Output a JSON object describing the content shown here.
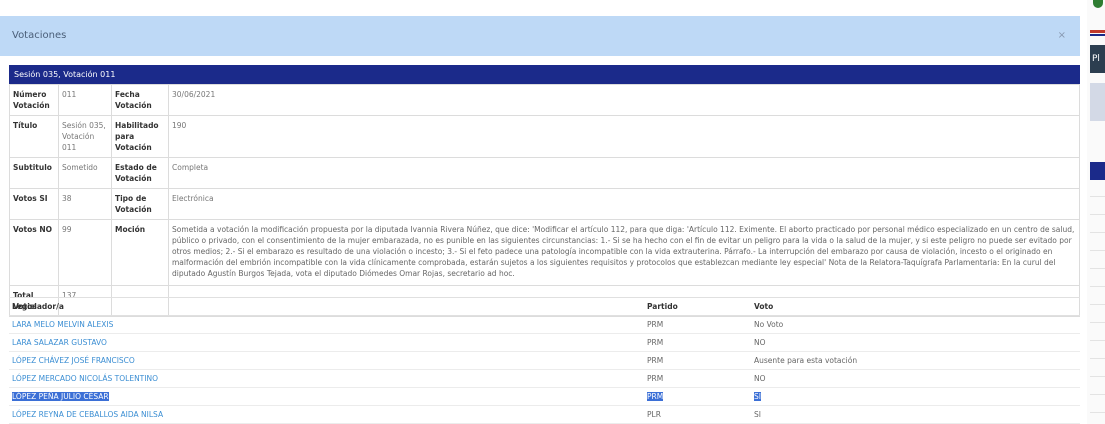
{
  "modal": {
    "title": "Votaciones",
    "close_label": "×"
  },
  "background": {
    "nav_label": "Pl"
  },
  "session": {
    "header": "Sesión 035, Votación 011"
  },
  "info": {
    "numero_votacion_label": "Número Votación",
    "numero_votacion": "011",
    "fecha_votacion_label": "Fecha Votación",
    "fecha_votacion": "30/06/2021",
    "titulo_label": "Título",
    "titulo": "Sesión 035, Votación 011",
    "habilitado_label": "Habilitado para Votación",
    "habilitado": "190",
    "subtitulo_label": "Subtitulo",
    "subtitulo": "Sometido",
    "estado_label": "Estado de Votación",
    "estado": "Completa",
    "votos_si_label": "Votos SI",
    "votos_si": "38",
    "tipo_label": "Tipo de Votación",
    "tipo": "Electrónica",
    "votos_no_label": "Votos NO",
    "votos_no": "99",
    "mocion_label": "Moción",
    "mocion": "Sometida a votación la modificación propuesta por la diputada Ivannia Rivera Núñez, que dice: 'Modificar el artículo 112, para que diga: 'Artículo 112. Eximente. El aborto practicado por personal médico especializado en un centro de salud, público o privado, con el consentimiento de la mujer embarazada, no es punible en las siguientes circunstancias: 1.- Si se ha hecho con el fin de evitar un peligro para la vida o la salud de la mujer, y si este peligro no puede ser evitado por otros medios; 2.- Si el embarazo es resultado de una violación o incesto; 3.- Si el feto padece una patología incompatible con la vida extrauterina. Párrafo.- La interrupción del embarazo por causa de violación, incesto o el originado en malformación del embrión incompatible con la vida clínicamente comprobada, estarán sujetos a los siguientes requisitos y protocolos que establezcan mediante ley especial' Nota de la Relatora-Taquígrafa Parlamentaria: En la curul del diputado Agustín Burgos Tejada, vota el diputado Diómedes Omar Rojas, secretario ad hoc.",
    "total_votos_label": "Total Votos",
    "total_votos": "137"
  },
  "votes": {
    "headers": {
      "legislador": "Legislador/a",
      "partido": "Partido",
      "voto": "Voto"
    },
    "rows": [
      {
        "name": "LARA MELO MELVIN ALEXIS",
        "partido": "PRM",
        "voto": "No Voto"
      },
      {
        "name": "LARA SALAZAR GUSTAVO",
        "partido": "PRM",
        "voto": "NO"
      },
      {
        "name": "LÓPEZ CHÁVEZ JOSÉ FRANCISCO",
        "partido": "PRM",
        "voto": "Ausente para esta votación"
      },
      {
        "name": "LÓPEZ MERCADO NICOLÁS TOLENTINO",
        "partido": "PRM",
        "voto": "NO"
      },
      {
        "name": "LÓPEZ PEÑA JULIO CÉSAR",
        "partido": "PRM",
        "voto": "SI"
      },
      {
        "name": "LÓPEZ REYNA DE CEBALLOS AIDA NILSA",
        "partido": "PLR",
        "voto": "SI"
      }
    ]
  },
  "colors": {
    "header_bg": "#bed9f6",
    "section_bar": "#1b2a8a",
    "link": "#3b8ed3",
    "selection": "#3b6fd6"
  }
}
